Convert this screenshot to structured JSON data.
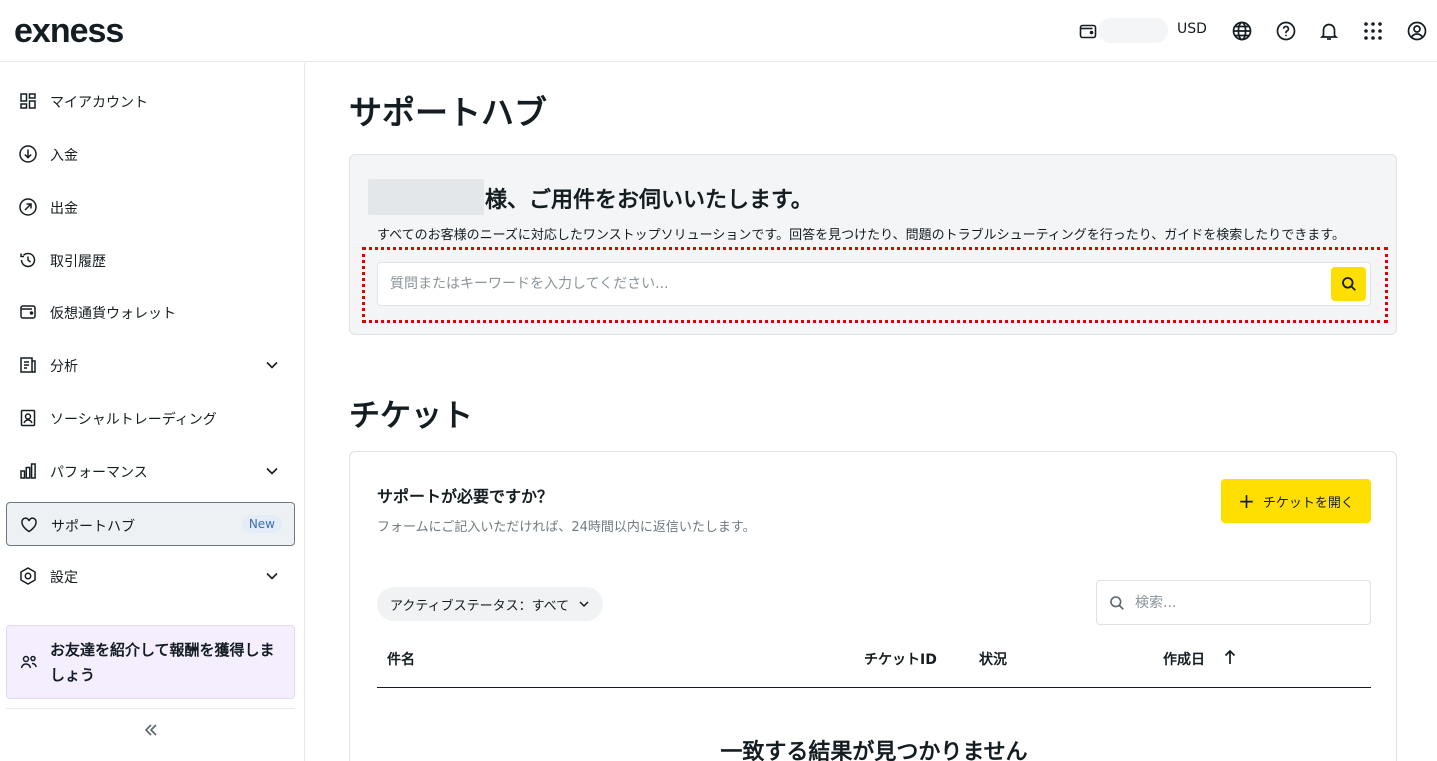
{
  "header": {
    "logo": "exness",
    "currency": "USD",
    "icons": [
      "wallet-icon",
      "globe-icon",
      "help-icon",
      "bell-icon",
      "apps-grid-icon",
      "profile-icon"
    ]
  },
  "sidebar": {
    "items": [
      {
        "label": "マイアカウント",
        "icon": "dashboard-icon"
      },
      {
        "label": "入金",
        "icon": "deposit-icon"
      },
      {
        "label": "出金",
        "icon": "withdraw-icon"
      },
      {
        "label": "取引履歴",
        "icon": "history-icon"
      },
      {
        "label": "仮想通貨ウォレット",
        "icon": "crypto-wallet-icon"
      },
      {
        "label": "分析",
        "icon": "analytics-icon"
      },
      {
        "label": "ソーシャルトレーディング",
        "icon": "social-trading-icon"
      },
      {
        "label": "パフォーマンス",
        "icon": "performance-icon"
      },
      {
        "label": "サポートハブ",
        "icon": "heart-icon",
        "badge": "New"
      },
      {
        "label": "設定",
        "icon": "settings-icon"
      }
    ],
    "referral": "お友達を紹介して報酬を獲得しましょう"
  },
  "main": {
    "title": "サポートハブ",
    "greeting": "様、ご用件をお伺いいたします。",
    "subtitle": "すべてのお客様のニーズに対応したワンストップソリューションです。回答を見つけたり、問題のトラブルシューティングを行ったり、ガイドを検索したりできます。",
    "search_placeholder": "質問またはキーワードを入力してください..."
  },
  "tickets": {
    "title": "チケット",
    "card_title": "サポートが必要ですか？",
    "card_sub": "フォームにご記入いただければ、24時間以内に返信いたします。",
    "open_button": "チケットを開く",
    "filter": "アクティブステータス：すべて",
    "search_placeholder": "検索...",
    "columns": [
      "件名",
      "チケットID",
      "状況",
      "作成日"
    ],
    "empty": "一致する結果が見つかりません"
  },
  "colors": {
    "accent": "#ffde02",
    "highlight": "#e00000",
    "referral_bg": "#f4eeff"
  }
}
